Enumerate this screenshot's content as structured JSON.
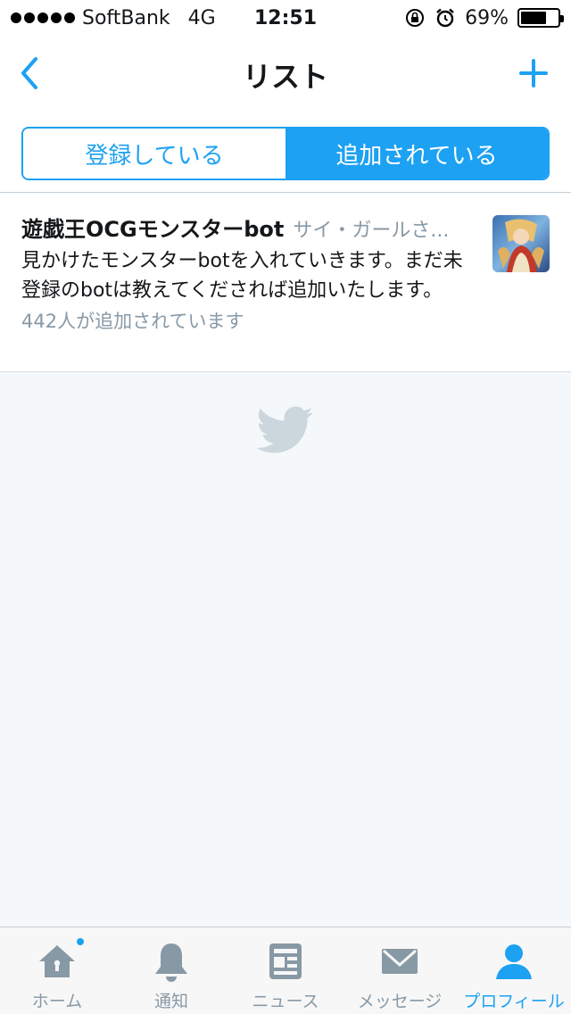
{
  "status_bar": {
    "carrier": "SoftBank",
    "network": "4G",
    "time": "12:51",
    "battery": "69%",
    "battery_level": 0.69
  },
  "nav": {
    "title": "リスト",
    "back_icon": "chevron-left-icon",
    "add_icon": "plus-icon"
  },
  "segments": {
    "subscribed": "登録している",
    "member_of": "追加されている",
    "active": "member_of"
  },
  "list": {
    "name": "遊戯王OCGモンスターbot",
    "owner": "サイ・ガールさ...",
    "description": "見かけたモンスターbotを入れていきます。まだ未登録のbotは教えてくだされば追加いたします。",
    "members": "442人が追加されています"
  },
  "tabs": [
    {
      "label": "ホーム",
      "icon": "home-icon"
    },
    {
      "label": "通知",
      "icon": "bell-icon"
    },
    {
      "label": "ニュース",
      "icon": "news-icon"
    },
    {
      "label": "メッセージ",
      "icon": "envelope-icon"
    },
    {
      "label": "プロフィール",
      "icon": "person-icon"
    }
  ],
  "colors": {
    "accent": "#1da1f2",
    "muted": "#8899a6",
    "background": "#f5f8fa"
  }
}
